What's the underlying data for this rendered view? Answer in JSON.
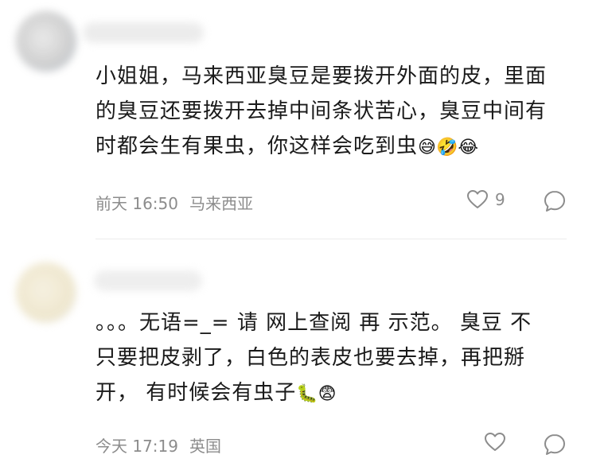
{
  "comments": [
    {
      "text": "小姐姐，马来西亚臭豆是要拨开外面的皮，里面\n的臭豆还要拨开去掉中间条状苦心，臭豆中间有\n时都会生有果虫，你这样会吃到虫",
      "emojis": "😅🤣😂",
      "time": "前天 16:50",
      "location": "马来西亚",
      "likes": "9"
    },
    {
      "text": "。。。无语=_= 请 网上查阅 再 示范。 臭豆 不\n只要把皮剥了，白色的表皮也要去掉，再把掰\n开， 有时候会有虫子",
      "emojis": "🐛😨",
      "time": "今天 17:19",
      "location": "英国",
      "likes": ""
    }
  ],
  "icons": {
    "like": "heart-outline-icon",
    "reply": "speech-bubble-icon"
  },
  "colors": {
    "text": "#1a1a1a",
    "meta": "#8c8c8c",
    "divider": "#ececec"
  }
}
